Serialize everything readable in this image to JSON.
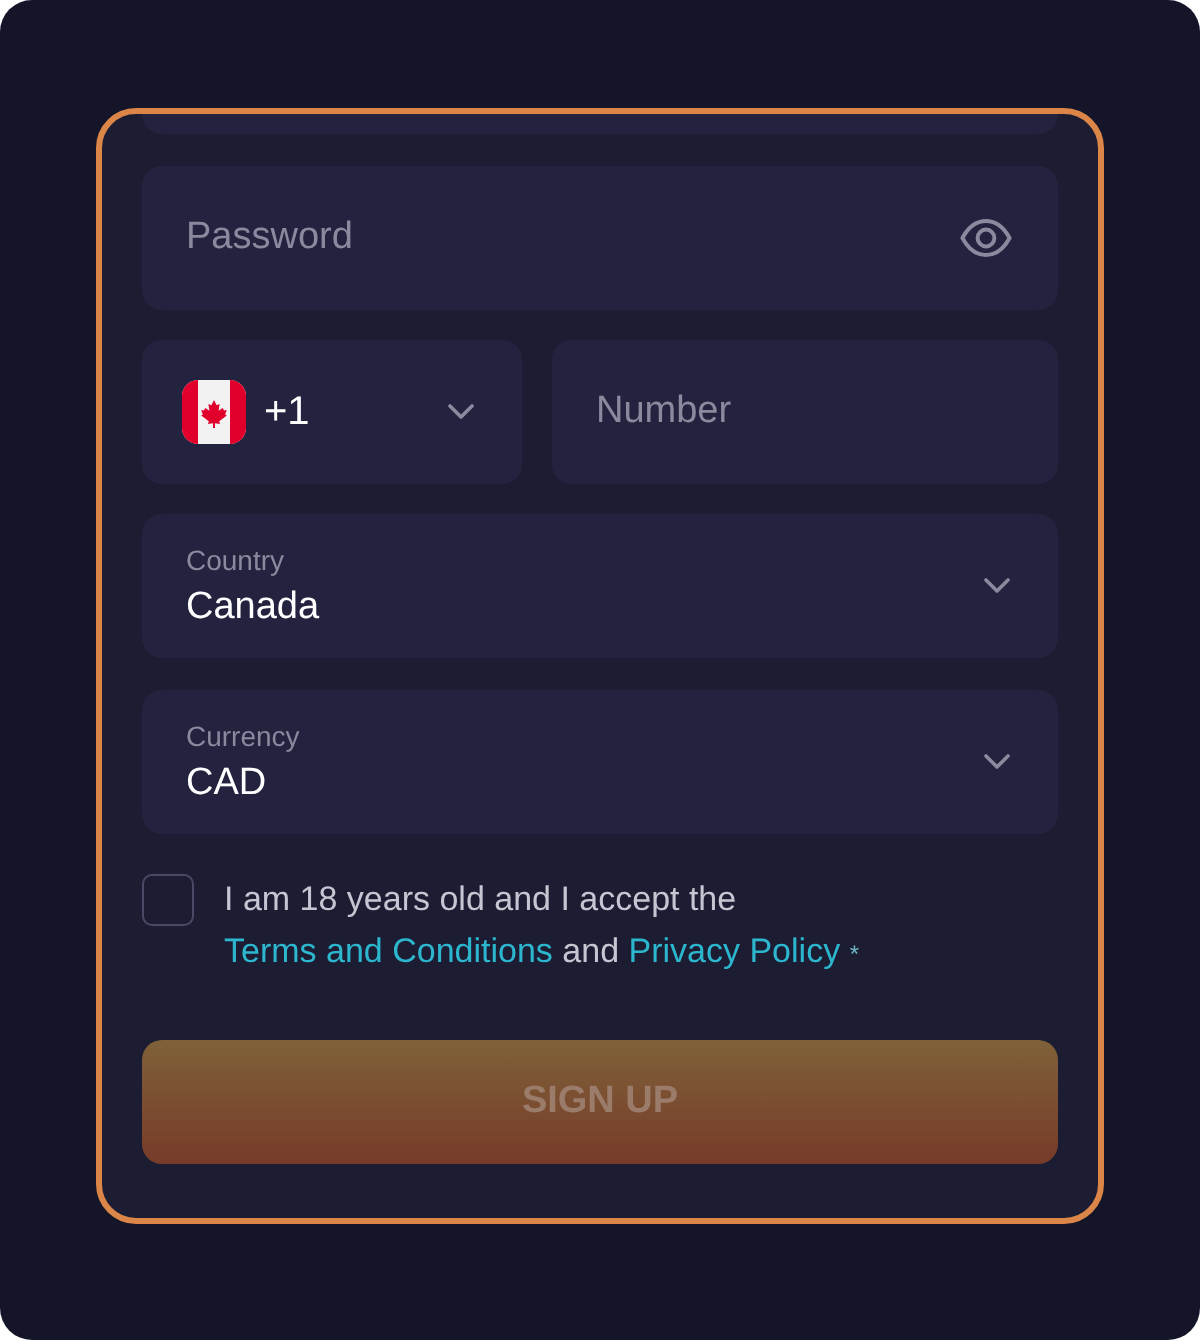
{
  "password": {
    "placeholder": "Password"
  },
  "phone": {
    "code": "+1",
    "placeholder": "Number"
  },
  "selects": [
    {
      "label": "Country",
      "value": "Canada"
    },
    {
      "label": "Currency",
      "value": "CAD"
    }
  ],
  "consent": {
    "checked": false,
    "parts": [
      {
        "kind": "text",
        "text": "I am 18 years old and I accept the"
      },
      {
        "kind": "link",
        "text": "Terms and Conditions"
      },
      {
        "kind": "text",
        "text": "and"
      },
      {
        "kind": "link",
        "text": "Privacy Policy"
      },
      {
        "kind": "mark",
        "text": "*"
      }
    ]
  },
  "submit": {
    "label": "SIGN UP",
    "disabled": true
  }
}
